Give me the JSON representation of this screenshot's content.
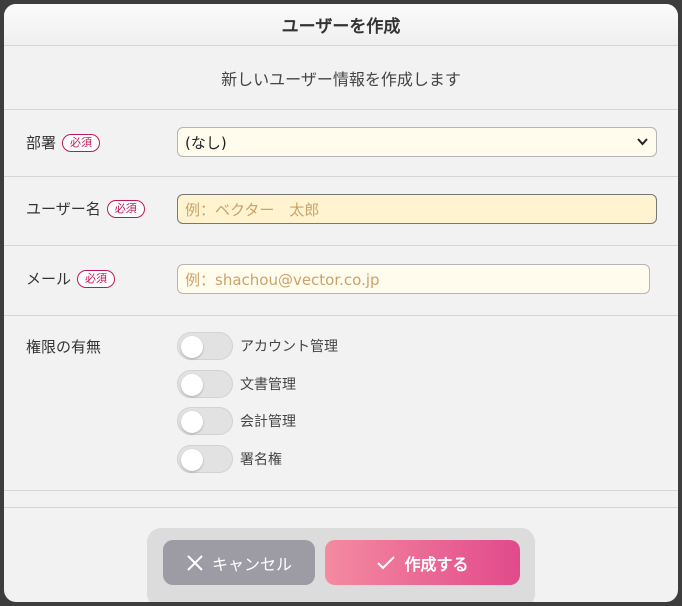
{
  "dialog": {
    "title": "ユーザーを作成",
    "subtitle": "新しいユーザー情報を作成します"
  },
  "fields": {
    "department": {
      "label": "部署",
      "required": "必須",
      "value": "(なし)"
    },
    "username": {
      "label": "ユーザー名",
      "required": "必須",
      "placeholder": "例：ベクター　太郎"
    },
    "email": {
      "label": "メール",
      "required": "必須",
      "placeholder": "例：shachou@vector.co.jp"
    }
  },
  "permissions": {
    "label": "権限の有無",
    "items": [
      {
        "label": "アカウント管理",
        "enabled": false
      },
      {
        "label": "文書管理",
        "enabled": false
      },
      {
        "label": "会計管理",
        "enabled": false
      },
      {
        "label": "署名権",
        "enabled": false
      }
    ]
  },
  "footer": {
    "cancel_label": "キャンセル",
    "create_label": "作成する"
  },
  "colors": {
    "required": "#c2185b",
    "create_start": "#f48aa0",
    "create_end": "#e14a8b",
    "cancel": "#9d9ba3"
  },
  "icons": {
    "cancel": "close-icon",
    "create": "check-icon",
    "select": "chevron-down-icon"
  }
}
